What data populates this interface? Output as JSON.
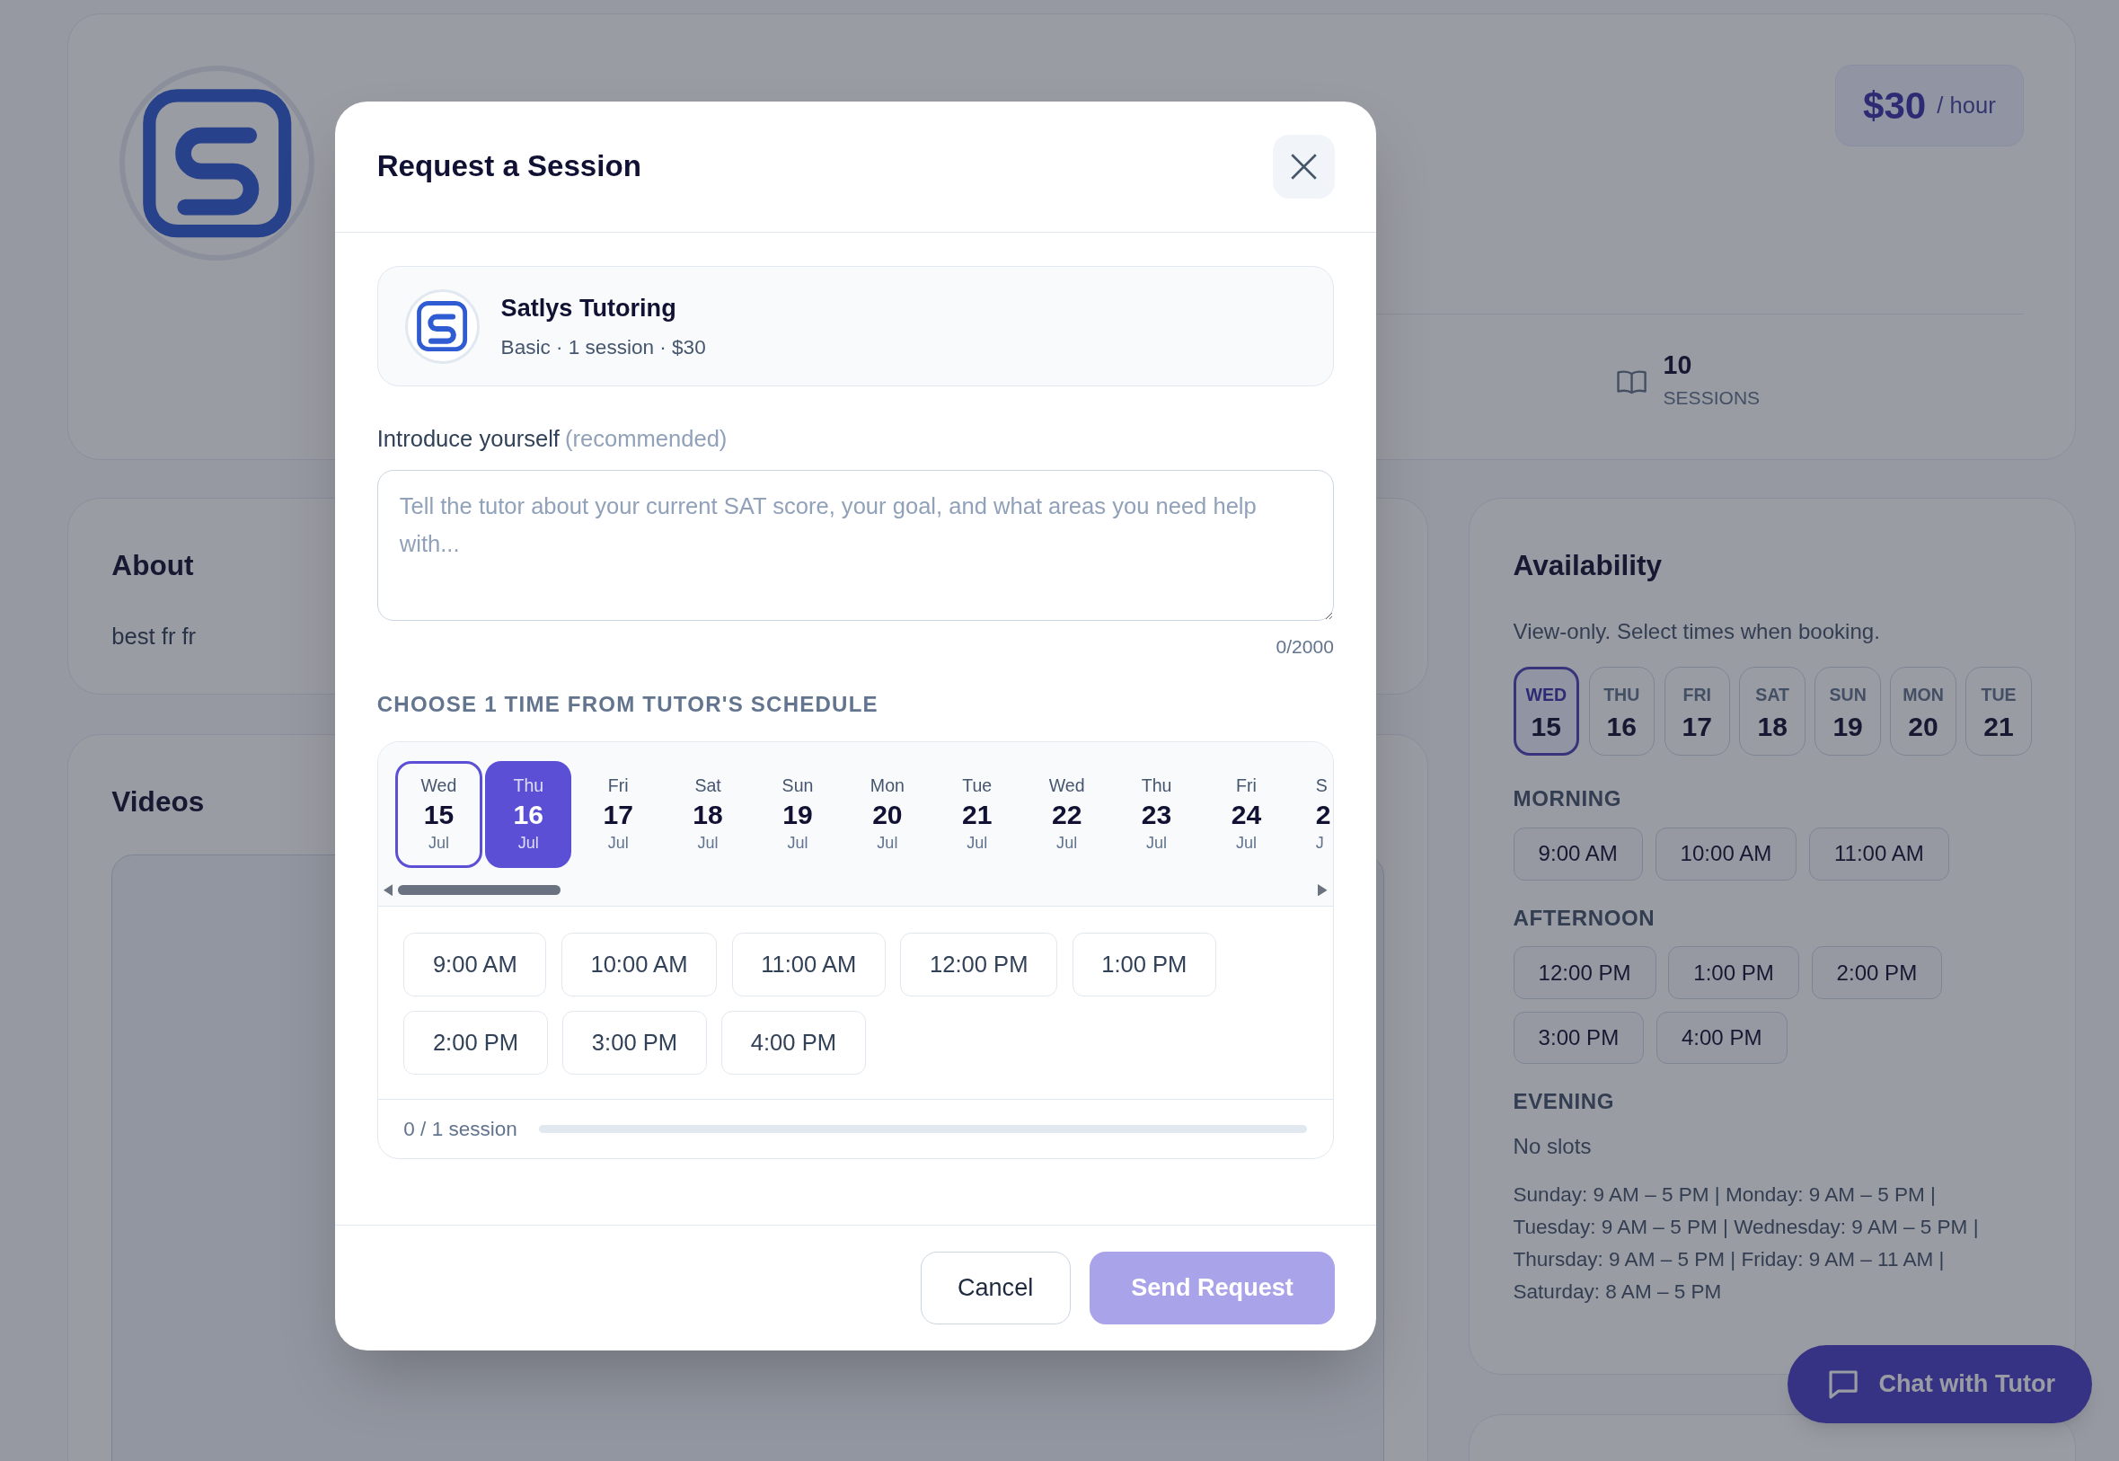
{
  "profile": {
    "price": "$30",
    "price_unit": "/ hour",
    "stats": [
      {
        "value": "10",
        "label": "SESSIONS"
      }
    ]
  },
  "about": {
    "title": "About",
    "text": "best fr fr"
  },
  "videos": {
    "title": "Videos"
  },
  "availability": {
    "title": "Availability",
    "note": "View-only. Select times when booking.",
    "days": [
      {
        "day": "WED",
        "date": "15",
        "selected": true
      },
      {
        "day": "THU",
        "date": "16",
        "selected": false
      },
      {
        "day": "FRI",
        "date": "17",
        "selected": false
      },
      {
        "day": "SAT",
        "date": "18",
        "selected": false
      },
      {
        "day": "SUN",
        "date": "19",
        "selected": false
      },
      {
        "day": "MON",
        "date": "20",
        "selected": false
      },
      {
        "day": "TUE",
        "date": "21",
        "selected": false
      }
    ],
    "groups": [
      {
        "title": "MORNING",
        "slots": [
          "9:00 AM",
          "10:00 AM",
          "11:00 AM"
        ]
      },
      {
        "title": "AFTERNOON",
        "slots": [
          "12:00 PM",
          "1:00 PM",
          "2:00 PM",
          "3:00 PM",
          "4:00 PM"
        ]
      },
      {
        "title": "EVENING",
        "empty_text": "No slots"
      }
    ],
    "summary": "Sunday: 9 AM – 5 PM | Monday: 9 AM – 5 PM | Tuesday: 9 AM – 5 PM | Wednesday: 9 AM – 5 PM | Thursday: 9 AM – 5 PM | Friday: 9 AM – 11 AM | Saturday: 8 AM – 5 PM"
  },
  "chat_button": {
    "label": "Chat with Tutor"
  },
  "modal": {
    "title": "Request a Session",
    "tutor": {
      "name": "Satlys Tutoring",
      "details": "Basic · 1 session · $30"
    },
    "intro": {
      "label": "Introduce yourself",
      "hint": "(recommended)",
      "placeholder": "Tell the tutor about your current SAT score, your goal, and what areas you need help with...",
      "counter": "0/2000"
    },
    "schedule": {
      "title": "CHOOSE 1 TIME FROM TUTOR'S SCHEDULE",
      "days": [
        {
          "weekday": "Wed",
          "date": "15",
          "month": "Jul",
          "today": true,
          "selected": false
        },
        {
          "weekday": "Thu",
          "date": "16",
          "month": "Jul",
          "today": false,
          "selected": true
        },
        {
          "weekday": "Fri",
          "date": "17",
          "month": "Jul",
          "today": false,
          "selected": false
        },
        {
          "weekday": "Sat",
          "date": "18",
          "month": "Jul",
          "today": false,
          "selected": false
        },
        {
          "weekday": "Sun",
          "date": "19",
          "month": "Jul",
          "today": false,
          "selected": false
        },
        {
          "weekday": "Mon",
          "date": "20",
          "month": "Jul",
          "today": false,
          "selected": false
        },
        {
          "weekday": "Tue",
          "date": "21",
          "month": "Jul",
          "today": false,
          "selected": false
        },
        {
          "weekday": "Wed",
          "date": "22",
          "month": "Jul",
          "today": false,
          "selected": false
        },
        {
          "weekday": "Thu",
          "date": "23",
          "month": "Jul",
          "today": false,
          "selected": false
        },
        {
          "weekday": "Fri",
          "date": "24",
          "month": "Jul",
          "today": false,
          "selected": false
        },
        {
          "weekday": "S",
          "date": "2",
          "month": "J",
          "today": false,
          "selected": false
        }
      ],
      "slots": [
        {
          "label": "9:00 AM",
          "selected": false
        },
        {
          "label": "10:00 AM",
          "selected": false
        },
        {
          "label": "11:00 AM",
          "selected": false
        },
        {
          "label": "12:00 PM",
          "selected": false
        },
        {
          "label": "1:00 PM",
          "selected": false
        },
        {
          "label": "2:00 PM",
          "selected": false
        },
        {
          "label": "3:00 PM",
          "selected": false
        },
        {
          "label": "4:00 PM",
          "selected": false
        }
      ],
      "progress": {
        "text": "0 / 1 session",
        "level": 0
      }
    },
    "buttons": [
      {
        "label": "Cancel",
        "kind": "secondary",
        "disabled": false
      },
      {
        "label": "Send Request",
        "kind": "primary",
        "disabled": true
      }
    ]
  }
}
